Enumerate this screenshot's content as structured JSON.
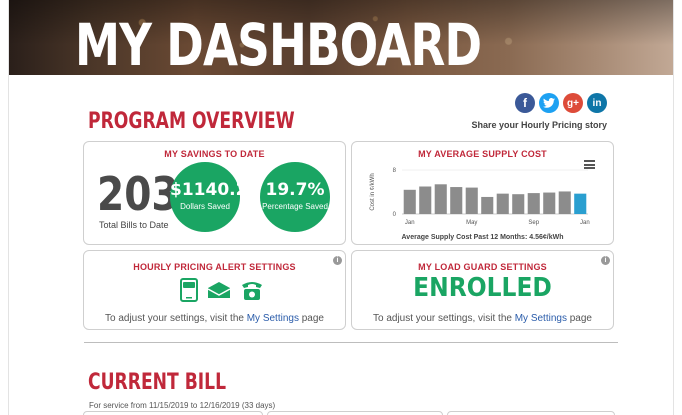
{
  "hero": {
    "title": "MY DASHBOARD"
  },
  "overview": {
    "title": "PROGRAM OVERVIEW",
    "share": {
      "text": "Share your Hourly Pricing story",
      "icons": [
        {
          "name": "facebook-icon",
          "glyph": "f",
          "color": "#3b5998"
        },
        {
          "name": "twitter-icon",
          "glyph": "t",
          "color": "#1da1f2"
        },
        {
          "name": "google-plus-icon",
          "glyph": "g+",
          "color": "#dd4b39"
        },
        {
          "name": "linkedin-icon",
          "glyph": "in",
          "color": "#0e76a8"
        }
      ]
    }
  },
  "savings": {
    "title": "MY SAVINGS TO DATE",
    "bills_count": "203",
    "bills_label": "Total Bills to Date",
    "dollars_value": "$1140.26",
    "dollars_label": "Dollars Saved",
    "percent_value": "19.7%",
    "percent_label": "Percentage Saved"
  },
  "supply": {
    "title": "MY AVERAGE SUPPLY COST",
    "footnote": "Average Supply Cost Past 12 Months: 4.56¢/kWh"
  },
  "chart_data": {
    "type": "bar",
    "categories": [
      "Jan",
      "Feb",
      "Mar",
      "Apr",
      "May",
      "Jun",
      "Jul",
      "Aug",
      "Sep",
      "Oct",
      "Nov",
      "Dec"
    ],
    "x_tick_labels": [
      "Jan",
      "May",
      "Sep",
      "Jan"
    ],
    "x_tick_positions": [
      0,
      4,
      8,
      12
    ],
    "values": [
      4.4,
      5.0,
      5.4,
      4.9,
      4.8,
      3.1,
      3.7,
      3.6,
      3.8,
      3.9,
      4.1,
      3.7
    ],
    "highlight_index": 11,
    "ylabel": "Cost in ¢/kWh",
    "yticks": [
      0,
      8
    ],
    "ylim": [
      0,
      8
    ],
    "colors": {
      "bar": "#8c8c8c",
      "highlight": "#2a9fd0"
    }
  },
  "alerts": {
    "title": "HOURLY PRICING ALERT SETTINGS",
    "adjust_prefix": "To adjust your settings, visit the ",
    "adjust_link": "My Settings",
    "adjust_suffix": " page",
    "icons": [
      "sms-phone-icon",
      "envelope-icon",
      "telephone-icon"
    ],
    "icon_color": "#1aa563"
  },
  "loadguard": {
    "title": "MY LOAD GUARD SETTINGS",
    "status": "ENROLLED",
    "adjust_prefix": "To adjust your settings, visit the ",
    "adjust_link": "My Settings",
    "adjust_suffix": " page"
  },
  "current_bill": {
    "title": "CURRENT BILL",
    "service_prefix": "For service from ",
    "service_from": "11/15/2019",
    "service_mid": " to ",
    "service_to": "12/16/2019",
    "service_days": " (33 days)"
  }
}
